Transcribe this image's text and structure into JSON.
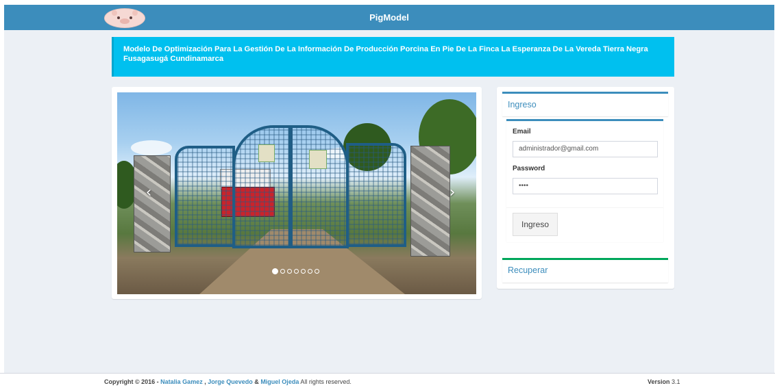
{
  "header": {
    "brand": "PigModel",
    "logo_icon": "pig-logo-icon",
    "bar_color": "#3c8dbc"
  },
  "banner": {
    "text": "Modelo De Optimización Para La Gestión De La Información De Producción Porcina En Pie De La Finca La Esperanza De La Vereda Tierra Negra Fusagasugá Cundinamarca",
    "color": "#00c0ef"
  },
  "carousel": {
    "prev_icon": "chevron-left-icon",
    "next_icon": "chevron-right-icon",
    "prev_glyph": "‹",
    "next_glyph": "›",
    "slide_count": 7,
    "active_index": 0
  },
  "login": {
    "title": "Ingreso",
    "email_label": "Email",
    "email_value": "administrador@gmail.com",
    "password_label": "Password",
    "password_value": "••••",
    "submit_label": "Ingreso"
  },
  "recover": {
    "title": "Recuperar"
  },
  "footer": {
    "copyright_prefix": "Copyright © 2016 -",
    "author1": "Natalia Gamez",
    "sep1": ",",
    "author2": "Jorge Quevedo",
    "sep2": "&",
    "author3": "Miguel Ojeda",
    "rights": "All rights reserved.",
    "version_label": "Version",
    "version_value": "3.1"
  }
}
